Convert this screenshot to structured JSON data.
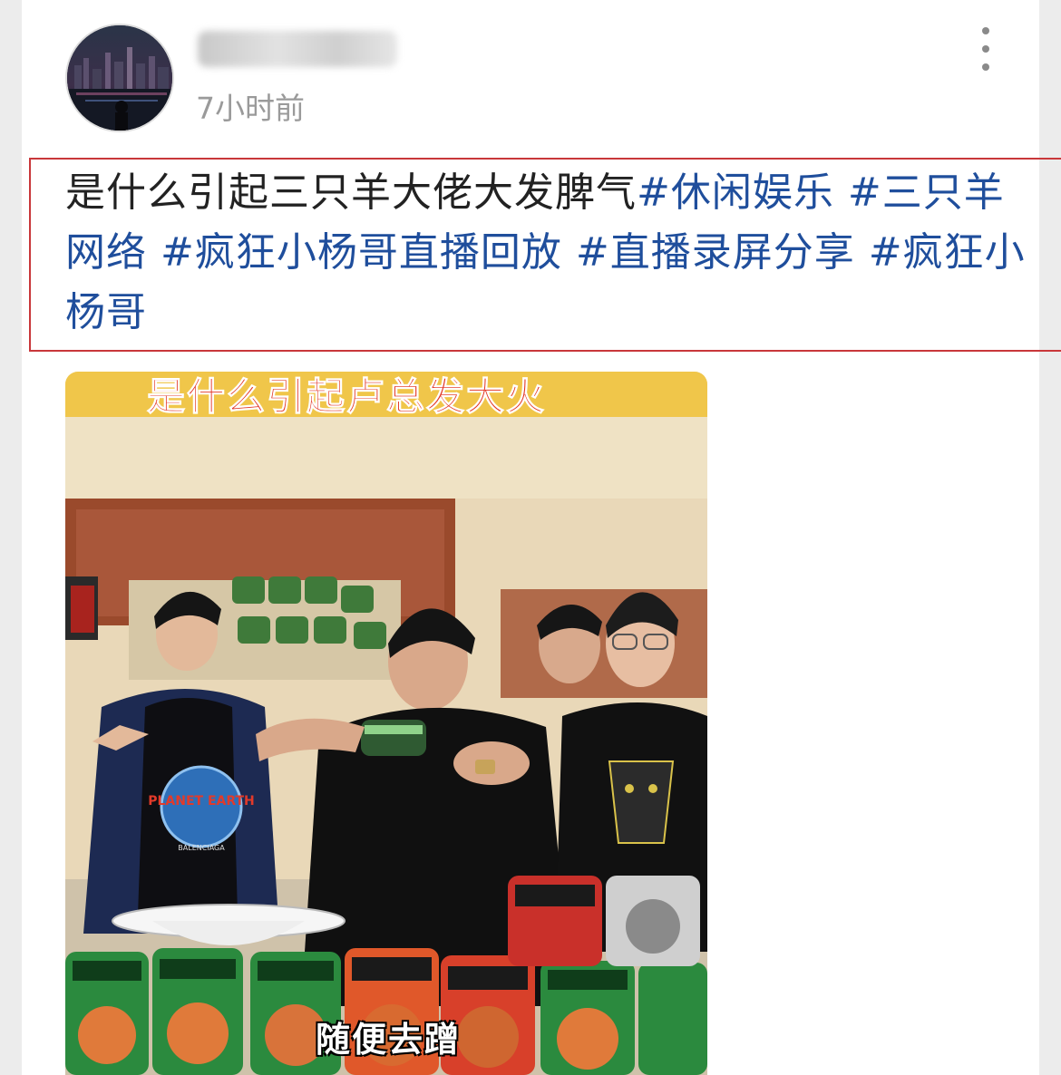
{
  "post": {
    "author_name": "██████",
    "timestamp": "7小时前",
    "text": "是什么引起三只羊大佬大发脾气",
    "hashtags": [
      "#休闲娱乐 ",
      "#三只羊网络 ",
      "#疯狂小杨哥直播回放 ",
      "#直播录屏分享 ",
      "#疯狂小杨哥"
    ],
    "highlight_color": "#c9373a",
    "hashtag_color": "#1f4e9c"
  },
  "media": {
    "overlay_title": "是什么引起卢总发大火",
    "subtitle": "随便去蹭",
    "shirt_text": "PLANET EARTH",
    "brand_text": "BALENCIAGA"
  },
  "icons": {
    "more": "vertical-ellipsis-icon",
    "avatar": "city-night-avatar"
  }
}
